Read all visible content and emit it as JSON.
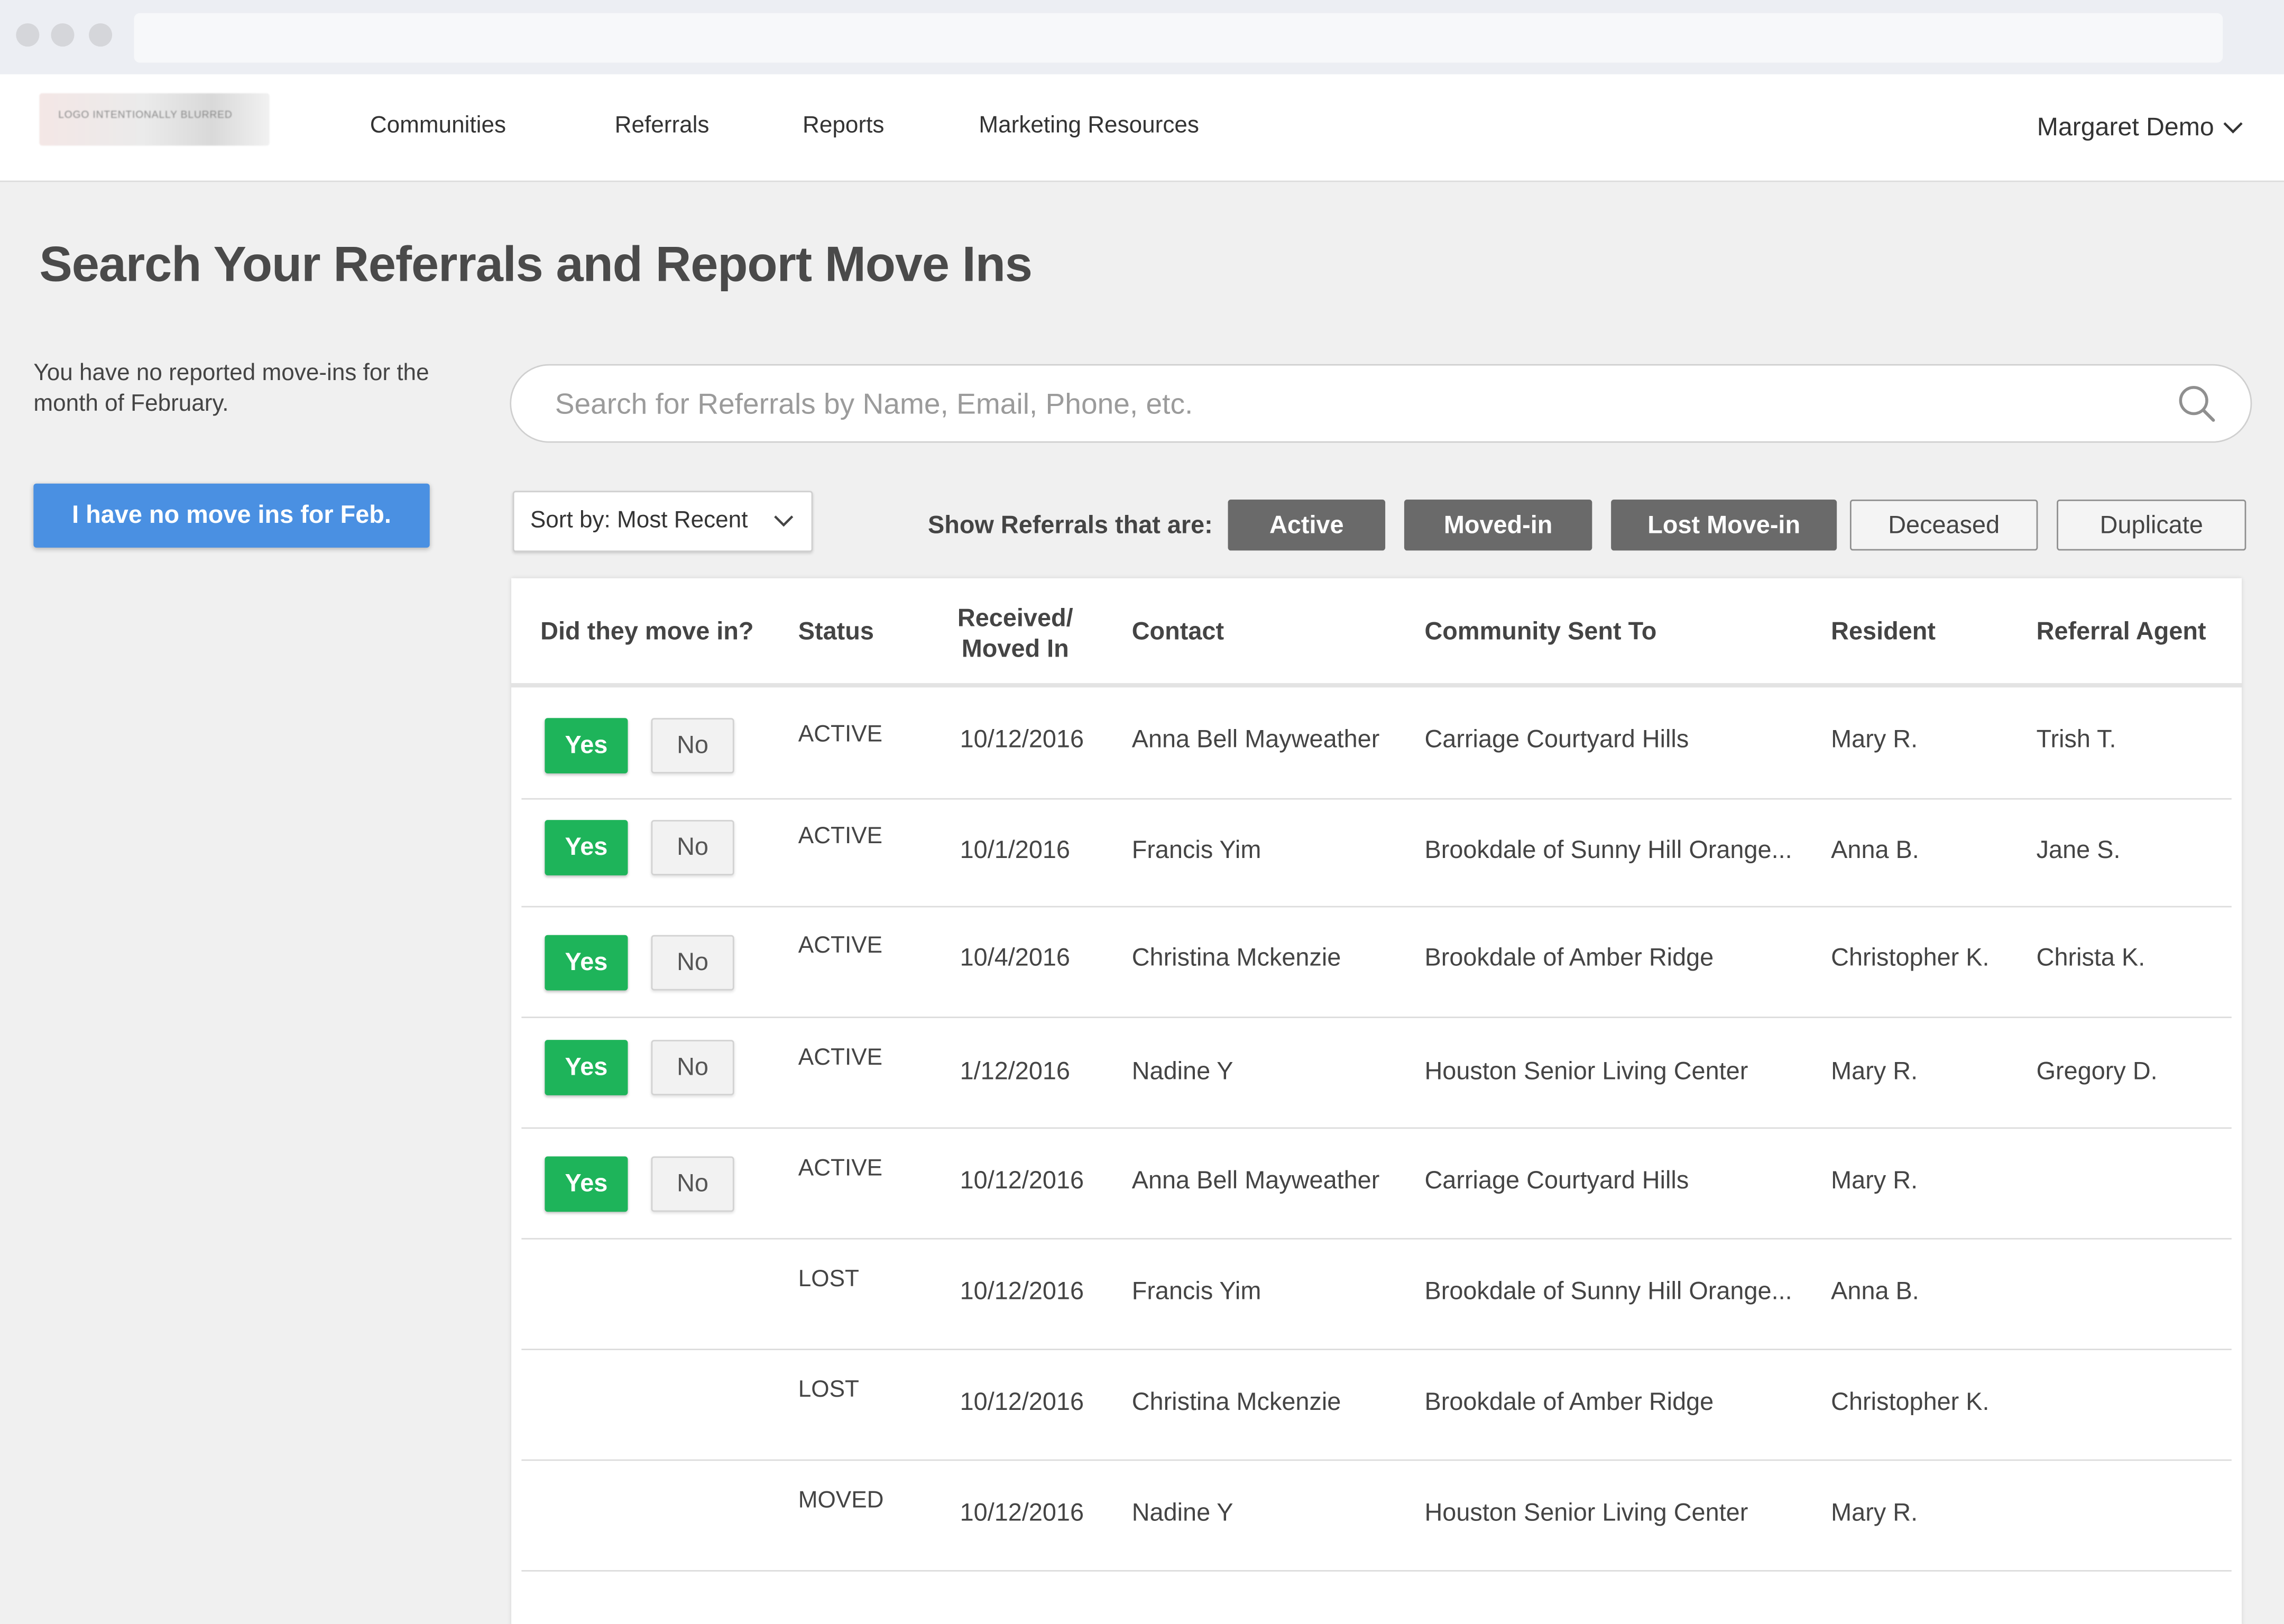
{
  "browser": {
    "address": ""
  },
  "logo": {
    "text": "LOGO INTENTIONALLY BLURRED"
  },
  "nav": {
    "links": [
      "Communities",
      "Referrals",
      "Reports",
      "Marketing Resources"
    ],
    "user": "Margaret Demo"
  },
  "page": {
    "title": "Search Your Referrals and Report Move Ins"
  },
  "sidebar": {
    "note": "You have no reported move-ins for the month of February.",
    "button": "I have no move ins for Feb."
  },
  "search": {
    "placeholder": "Search for Referrals by Name, Email, Phone, etc.",
    "value": ""
  },
  "sort": {
    "label": "Sort by: Most Recent"
  },
  "filters": {
    "label": "Show Referrals that are:",
    "options": [
      {
        "label": "Active",
        "selected": true
      },
      {
        "label": "Moved-in",
        "selected": true
      },
      {
        "label": "Lost Move-in",
        "selected": true
      },
      {
        "label": "Deceased",
        "selected": false
      },
      {
        "label": "Duplicate",
        "selected": false
      }
    ]
  },
  "table": {
    "columns": [
      "Did they move in?",
      "Status",
      "Received/",
      "Moved In",
      "Contact",
      "Community Sent To",
      "Resident",
      "Referral Agent"
    ],
    "yes_label": "Yes",
    "no_label": "No",
    "rows": [
      {
        "show_buttons": true,
        "status": "ACTIVE",
        "date": "10/12/2016",
        "contact": "Anna Bell Mayweather",
        "community": "Carriage Courtyard Hills",
        "resident": "Mary R.",
        "agent": "Trish T."
      },
      {
        "show_buttons": true,
        "status": "ACTIVE",
        "date": "10/1/2016",
        "contact": "Francis Yim",
        "community": "Brookdale of Sunny Hill Orange...",
        "resident": "Anna B.",
        "agent": "Jane S."
      },
      {
        "show_buttons": true,
        "status": "ACTIVE",
        "date": "10/4/2016",
        "contact": "Christina Mckenzie",
        "community": "Brookdale of Amber Ridge",
        "resident": "Christopher K.",
        "agent": "Christa K."
      },
      {
        "show_buttons": true,
        "status": "ACTIVE",
        "date": "1/12/2016",
        "contact": "Nadine Y",
        "community": "Houston Senior Living Center",
        "resident": "Mary R.",
        "agent": "Gregory D."
      },
      {
        "show_buttons": true,
        "status": "ACTIVE",
        "date": "10/12/2016",
        "contact": "Anna Bell Mayweather",
        "community": "Carriage Courtyard Hills",
        "resident": "Mary R.",
        "agent": ""
      },
      {
        "show_buttons": false,
        "status": "LOST",
        "date": "10/12/2016",
        "contact": "Francis Yim",
        "community": "Brookdale of Sunny Hill Orange...",
        "resident": "Anna B.",
        "agent": ""
      },
      {
        "show_buttons": false,
        "status": "LOST",
        "date": "10/12/2016",
        "contact": "Christina Mckenzie",
        "community": "Brookdale of Amber Ridge",
        "resident": "Christopher K.",
        "agent": ""
      },
      {
        "show_buttons": false,
        "status": "MOVED",
        "date": "10/12/2016",
        "contact": "Nadine Y",
        "community": "Houston Senior Living Center",
        "resident": "Mary R.",
        "agent": ""
      }
    ]
  },
  "colors": {
    "primary": "#4a90e2",
    "yes": "#1eb45a",
    "filter_on": "#6a6a6a"
  }
}
